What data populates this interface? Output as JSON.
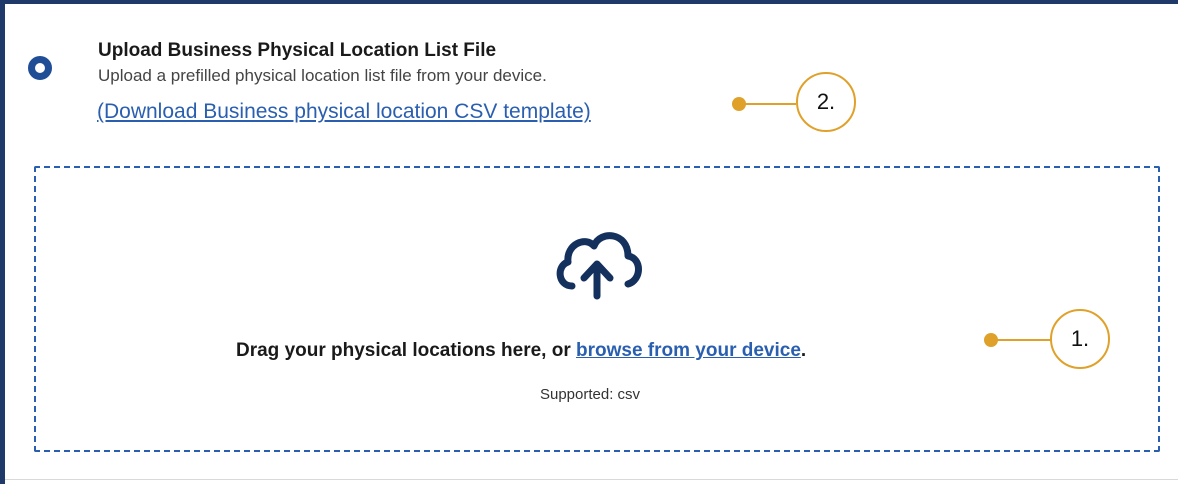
{
  "option": {
    "title": "Upload Business Physical Location List File",
    "description": "Upload a prefilled physical location list file from your device.",
    "template_link": "(Download Business physical location CSV template)",
    "selected": true
  },
  "dropzone": {
    "prompt": "Drag your physical locations here, or",
    "browse_link": "browse from your device",
    "period": ".",
    "supported": "Supported: csv",
    "icon": "cloud-upload-icon"
  },
  "callouts": [
    {
      "label": "1."
    },
    {
      "label": "2."
    }
  ],
  "colors": {
    "brand_navy": "#1f3a68",
    "link_blue": "#2a5fb0",
    "callout_gold": "#e0a12b"
  }
}
